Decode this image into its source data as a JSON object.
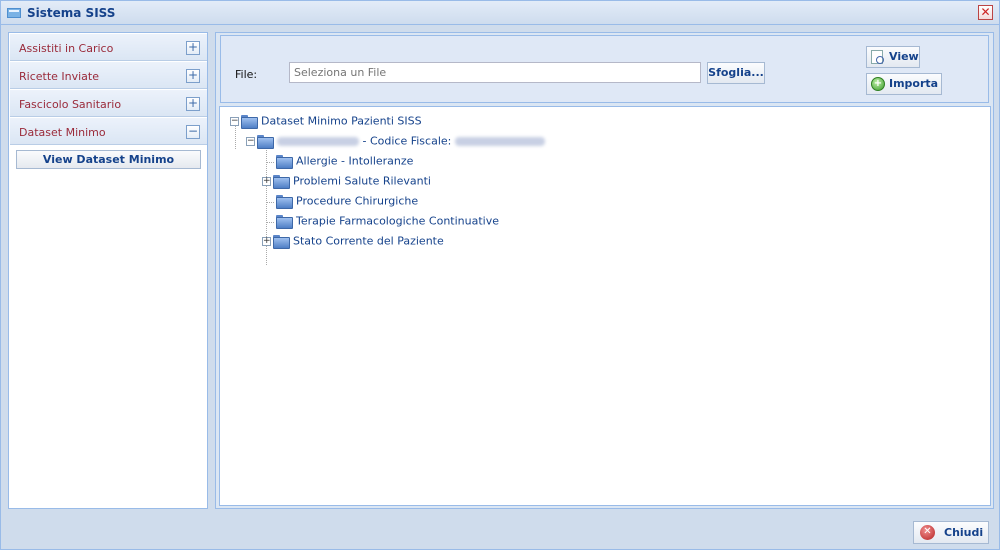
{
  "window": {
    "title": "Sistema SISS",
    "title_icon": "window-icon",
    "close_glyph": "✕"
  },
  "sidebar": {
    "items": [
      {
        "label": "Assistiti in Carico",
        "toggle": "+"
      },
      {
        "label": "Ricette Inviate",
        "toggle": "+"
      },
      {
        "label": "Fascicolo Sanitario",
        "toggle": "+"
      },
      {
        "label": "Dataset Minimo",
        "toggle": "−"
      }
    ],
    "view_dataset_label": "View Dataset Minimo"
  },
  "file_bar": {
    "label": "File:",
    "placeholder": "Seleziona un File",
    "value": "",
    "browse_label": "Sfoglia...",
    "view_label": "View",
    "import_label": "Importa"
  },
  "tree": {
    "root": {
      "label": "Dataset Minimo Pazienti SISS",
      "toggle": "−"
    },
    "patient": {
      "toggle": "−",
      "separator": " - Codice Fiscale: "
    },
    "children": [
      {
        "label": "Allergie - Intolleranze",
        "toggle": ""
      },
      {
        "label": "Problemi Salute Rilevanti",
        "toggle": "+"
      },
      {
        "label": "Procedure Chirurgiche",
        "toggle": ""
      },
      {
        "label": "Terapie Farmacologiche Continuative",
        "toggle": ""
      },
      {
        "label": "Stato Corrente del Paziente",
        "toggle": "+"
      }
    ]
  },
  "footer": {
    "close_label": "Chiudi",
    "close_icon_glyph": "✕"
  }
}
